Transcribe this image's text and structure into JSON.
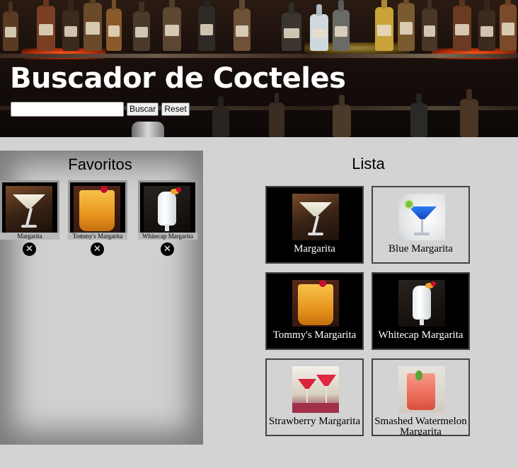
{
  "header": {
    "title": "Buscador de Cocteles",
    "search": {
      "value": "",
      "placeholder": ""
    },
    "search_button": "Buscar",
    "reset_button": "Reset"
  },
  "favorites": {
    "title": "Favoritos",
    "items": [
      {
        "name": "Margarita",
        "icon": "close-circle-icon"
      },
      {
        "name": "Tommy's Margarita",
        "icon": "close-circle-icon"
      },
      {
        "name": "Whitecap Margarita",
        "icon": "close-circle-icon"
      }
    ]
  },
  "list": {
    "title": "Lista",
    "items": [
      {
        "name": "Margarita",
        "favorited": true
      },
      {
        "name": "Blue Margarita",
        "favorited": false
      },
      {
        "name": "Tommy's Margarita",
        "favorited": true
      },
      {
        "name": "Whitecap Margarita",
        "favorited": true
      },
      {
        "name": "Strawberry Margarita",
        "favorited": false
      },
      {
        "name": "Smashed Watermelon Margarita",
        "favorited": false
      }
    ]
  },
  "colors": {
    "page_bg": "#d3d3d3",
    "favorited_card_bg": "#000000",
    "card_bg": "#d3d3d3",
    "title_text": "#ffffff"
  }
}
